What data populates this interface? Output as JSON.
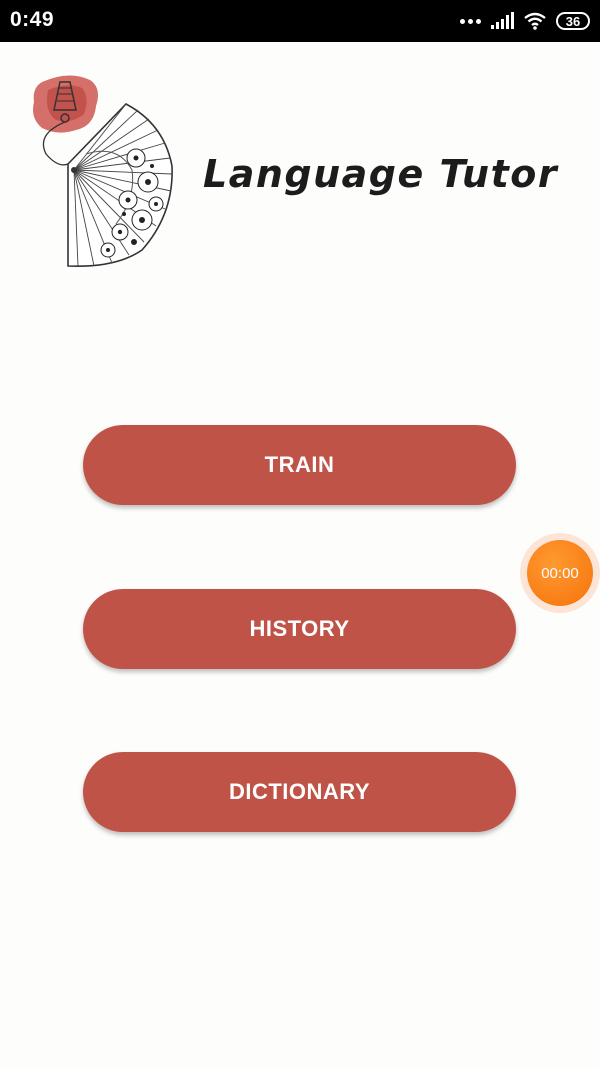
{
  "status_bar": {
    "time": "0:49",
    "battery_level": "36",
    "icons": [
      "more-dots-icon",
      "signal-icon",
      "wifi-icon",
      "battery-icon"
    ]
  },
  "app": {
    "title": "Language Tutor",
    "logo_icon": "folding-fan-logo"
  },
  "menu": {
    "train_label": "TRAIN",
    "history_label": "HISTORY",
    "dictionary_label": "DICTIONARY"
  },
  "timer": {
    "label": "00:00"
  },
  "colors": {
    "button_bg": "#c05348",
    "timer_bg": "#f5720b",
    "page_bg": "#fdfdfc"
  }
}
